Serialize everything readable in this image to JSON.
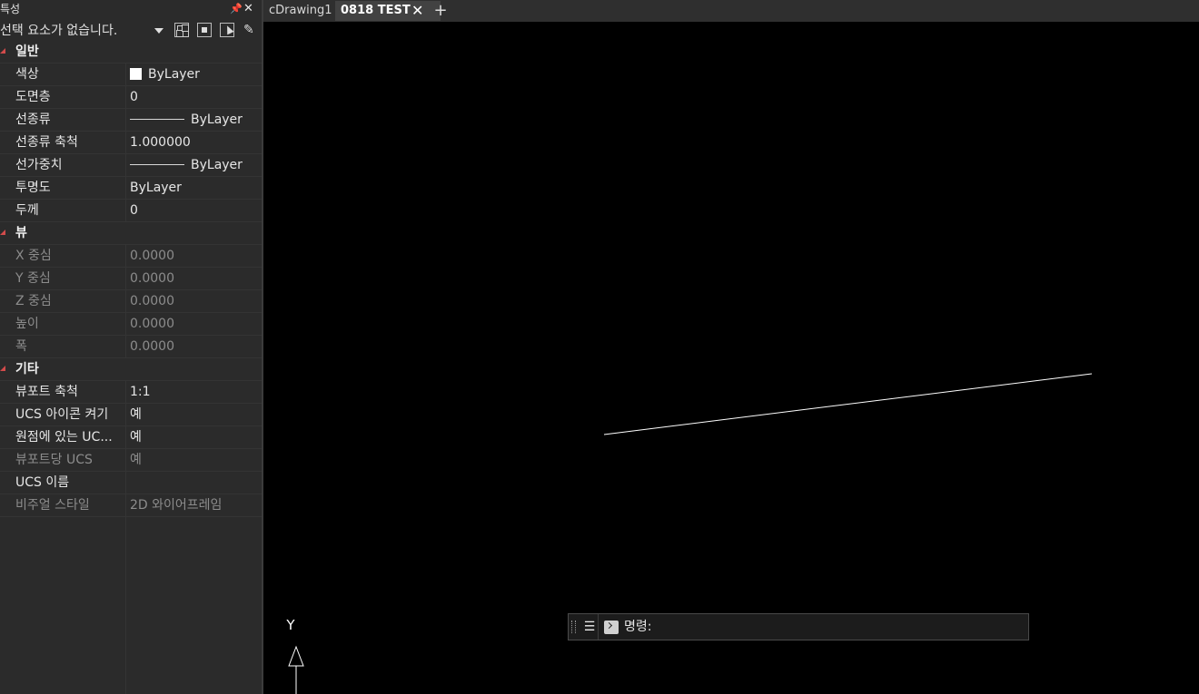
{
  "properties_panel": {
    "title": "특성",
    "pin_glyph": "📌",
    "close_glyph": "✕",
    "selection": "선택 요소가 없습니다.",
    "categories": [
      {
        "name": "일반",
        "rows": [
          {
            "key": "색상",
            "value": "ByLayer",
            "disabled": false
          },
          {
            "key": "도면층",
            "value": "0",
            "disabled": false
          },
          {
            "key": "선종류",
            "value": "ByLayer",
            "disabled": false
          },
          {
            "key": "선종류 축척",
            "value": "1.000000",
            "disabled": false
          },
          {
            "key": "선가중치",
            "value": "ByLayer",
            "disabled": false
          },
          {
            "key": "투명도",
            "value": "ByLayer",
            "disabled": false
          },
          {
            "key": "두께",
            "value": "0",
            "disabled": false
          }
        ]
      },
      {
        "name": "뷰",
        "rows": [
          {
            "key": "X 중심",
            "value": "0.0000",
            "disabled": true
          },
          {
            "key": "Y 중심",
            "value": "0.0000",
            "disabled": true
          },
          {
            "key": "Z 중심",
            "value": "0.0000",
            "disabled": true
          },
          {
            "key": "높이",
            "value": "0.0000",
            "disabled": true
          },
          {
            "key": "폭",
            "value": "0.0000",
            "disabled": true
          }
        ]
      },
      {
        "name": "기타",
        "rows": [
          {
            "key": "뷰포트 축척",
            "value": "1:1",
            "disabled": false
          },
          {
            "key": "UCS 아이콘 켜기",
            "value": "예",
            "disabled": false
          },
          {
            "key": "원점에 있는 UC...",
            "value": "예",
            "disabled": false
          },
          {
            "key": "뷰포트당 UCS",
            "value": "예",
            "disabled": true
          },
          {
            "key": "UCS 이름",
            "value": "",
            "disabled": false
          },
          {
            "key": "비주얼 스타일",
            "value": "2D 와이어프레임",
            "disabled": true
          }
        ]
      }
    ]
  },
  "tabs": [
    {
      "label": "cDrawing1",
      "active": false
    },
    {
      "label": "0818 TEST",
      "active": true
    }
  ],
  "tab_close_glyph": "✕",
  "tab_add_glyph": "+",
  "canvas": {
    "ucs_axis_label": "Y",
    "background": "#000000",
    "line_color": "#ffffff"
  },
  "command_line": {
    "menu_glyph": "☰",
    "prompt_label": "명령:",
    "value": ""
  },
  "colors": {
    "panel_bg": "#2b2b2b",
    "category_marker": "#d24b4b",
    "active_tab": "#424242"
  }
}
